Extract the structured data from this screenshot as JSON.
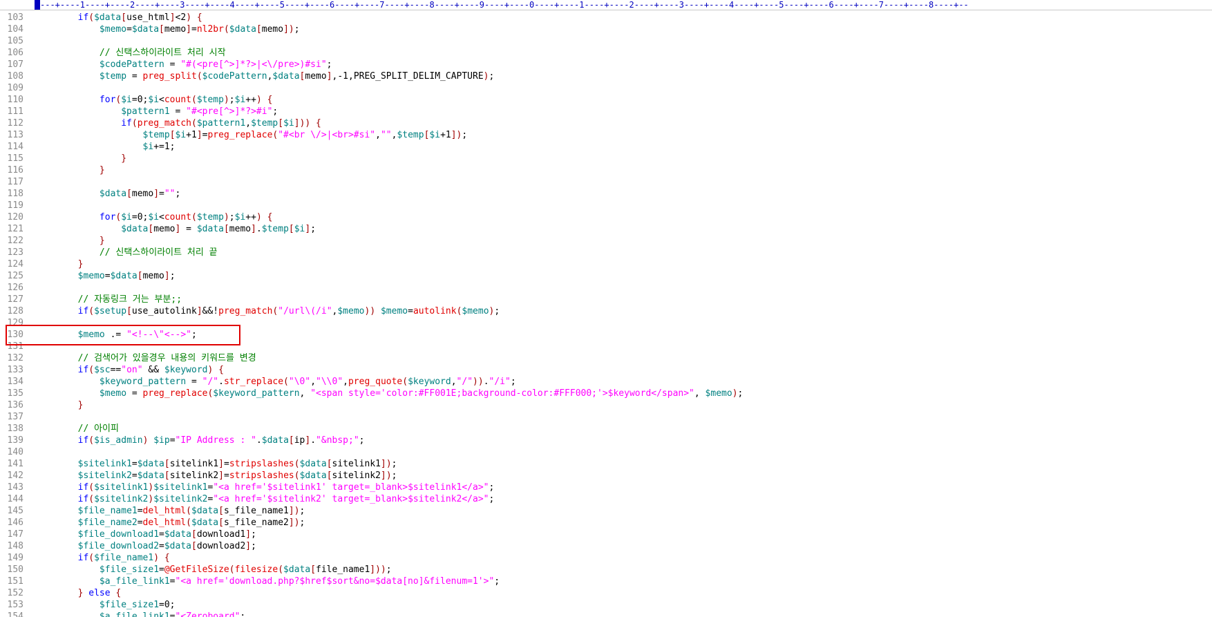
{
  "ruler": {
    "text": "---+----1----+----2----+----3----+----4----+----5----+----6----+----7----+----8----+----9----+----0----+----1----+----2----+----3----+----4----+----5----+----6----+----7----+----8----+--"
  },
  "colors": {
    "keyword": "#0000ff",
    "variable": "#008080",
    "function": "#e00000",
    "string": "#ff00ff",
    "comment": "#008000",
    "highlight_box": "#e00000",
    "line_number": "#8a8a8a"
  },
  "lines": [
    {
      "n": "103",
      "code": "        if($data[use_html]<2) {"
    },
    {
      "n": "104",
      "code": "            $memo=$data[memo]=nl2br($data[memo]);"
    },
    {
      "n": "105",
      "code": ""
    },
    {
      "n": "106",
      "code": "            // 신택스하이라이트 처리 시작"
    },
    {
      "n": "107",
      "code": "            $codePattern = \"#(<pre[^>]*?>|<\\/pre>)#si\";"
    },
    {
      "n": "108",
      "code": "            $temp = preg_split($codePattern,$data[memo],-1,PREG_SPLIT_DELIM_CAPTURE);"
    },
    {
      "n": "109",
      "code": ""
    },
    {
      "n": "110",
      "code": "            for($i=0;$i<count($temp);$i++) {"
    },
    {
      "n": "111",
      "code": "                $pattern1 = \"#<pre[^>]*?>#i\";"
    },
    {
      "n": "112",
      "code": "                if(preg_match($pattern1,$temp[$i])) {"
    },
    {
      "n": "113",
      "code": "                    $temp[$i+1]=preg_replace(\"#<br \\/>|<br>#si\",\"\",$temp[$i+1]);"
    },
    {
      "n": "114",
      "code": "                    $i+=1;"
    },
    {
      "n": "115",
      "code": "                }"
    },
    {
      "n": "116",
      "code": "            }"
    },
    {
      "n": "117",
      "code": ""
    },
    {
      "n": "118",
      "code": "            $data[memo]=\"\";"
    },
    {
      "n": "119",
      "code": ""
    },
    {
      "n": "120",
      "code": "            for($i=0;$i<count($temp);$i++) {"
    },
    {
      "n": "121",
      "code": "                $data[memo] = $data[memo].$temp[$i];"
    },
    {
      "n": "122",
      "code": "            }"
    },
    {
      "n": "123",
      "code": "            // 신택스하이라이트 처리 끝"
    },
    {
      "n": "124",
      "code": "        }"
    },
    {
      "n": "125",
      "code": "        $memo=$data[memo];"
    },
    {
      "n": "126",
      "code": ""
    },
    {
      "n": "127",
      "code": "        // 자동링크 거는 부분;;"
    },
    {
      "n": "128",
      "code": "        if($setup[use_autolink]&&!preg_match(\"/url\\(/i\",$memo)) $memo=autolink($memo);"
    },
    {
      "n": "129",
      "code": ""
    },
    {
      "n": "130",
      "code": "        $memo .= \"<!--\\\"<-->\";"
    },
    {
      "n": "131",
      "code": ""
    },
    {
      "n": "132",
      "code": "        // 검색어가 있을경우 내용의 키워드를 변경"
    },
    {
      "n": "133",
      "code": "        if($sc==\"on\" && $keyword) {"
    },
    {
      "n": "134",
      "code": "            $keyword_pattern = \"/\".str_replace(\"\\0\",\"\\\\0\",preg_quote($keyword,\"/\")).\"/i\";"
    },
    {
      "n": "135",
      "code": "            $memo = preg_replace($keyword_pattern, \"<span style='color:#FF001E;background-color:#FFF000;'>$keyword</span>\", $memo);"
    },
    {
      "n": "136",
      "code": "        }"
    },
    {
      "n": "137",
      "code": ""
    },
    {
      "n": "138",
      "code": "        // 아이피"
    },
    {
      "n": "139",
      "code": "        if($is_admin) $ip=\"IP Address : \".$data[ip].\"&nbsp;\";"
    },
    {
      "n": "140",
      "code": ""
    },
    {
      "n": "141",
      "code": "        $sitelink1=$data[sitelink1]=stripslashes($data[sitelink1]);"
    },
    {
      "n": "142",
      "code": "        $sitelink2=$data[sitelink2]=stripslashes($data[sitelink2]);"
    },
    {
      "n": "143",
      "code": "        if($sitelink1)$sitelink1=\"<a href='$sitelink1' target=_blank>$sitelink1</a>\";"
    },
    {
      "n": "144",
      "code": "        if($sitelink2)$sitelink2=\"<a href='$sitelink2' target=_blank>$sitelink2</a>\";"
    },
    {
      "n": "145",
      "code": "        $file_name1=del_html($data[s_file_name1]);"
    },
    {
      "n": "146",
      "code": "        $file_name2=del_html($data[s_file_name2]);"
    },
    {
      "n": "147",
      "code": "        $file_download1=$data[download1];"
    },
    {
      "n": "148",
      "code": "        $file_download2=$data[download2];"
    },
    {
      "n": "149",
      "code": "        if($file_name1) {"
    },
    {
      "n": "150",
      "code": "            $file_size1=@GetFileSize(filesize($data[file_name1]));"
    },
    {
      "n": "151",
      "code": "            $a_file_link1=\"<a href='download.php?$href$sort&no=$data[no]&filenum=1'>\";"
    },
    {
      "n": "152",
      "code": "        } else {"
    },
    {
      "n": "153",
      "code": "            $file_size1=0;"
    },
    {
      "n": "154",
      "code": "            $a_file_link1=\"<Zeroboard\";"
    }
  ]
}
